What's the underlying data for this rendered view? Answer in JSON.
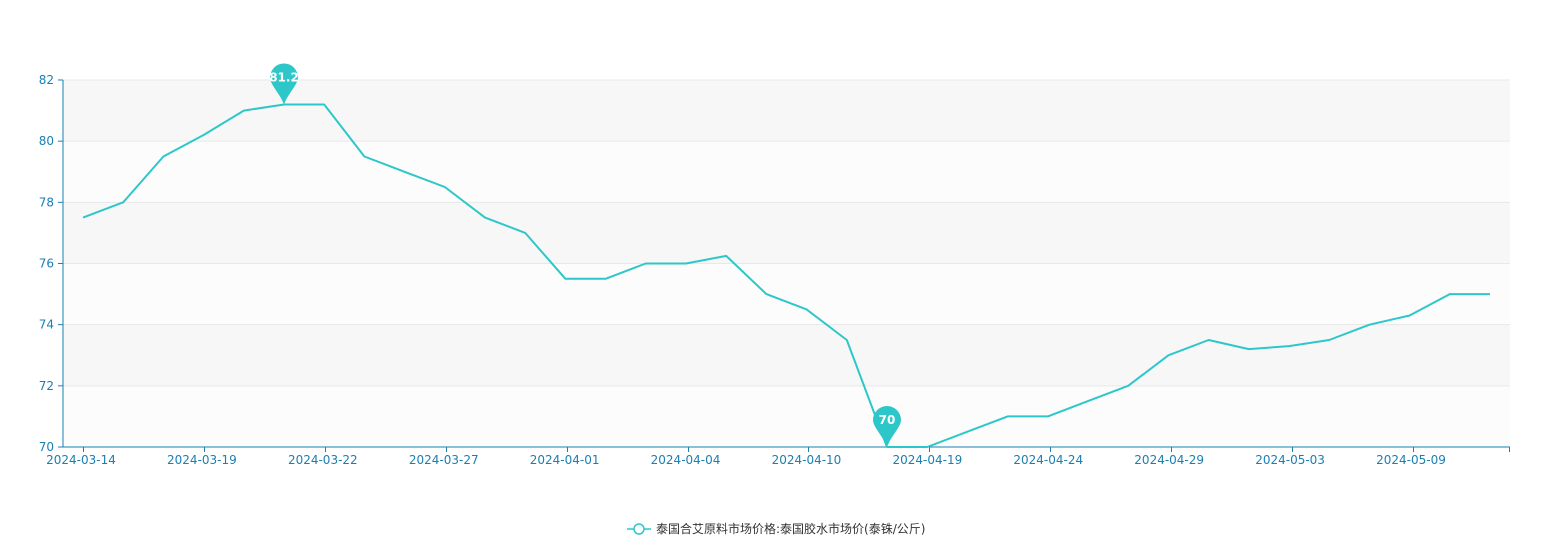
{
  "chart_data": {
    "type": "line",
    "title": "",
    "xlabel": "",
    "ylabel": "",
    "ylim": [
      70,
      82
    ],
    "yticks": [
      70,
      72,
      74,
      76,
      78,
      80,
      82
    ],
    "xtick_labels": [
      "2024-03-14",
      "2024-03-19",
      "2024-03-22",
      "2024-03-27",
      "2024-04-01",
      "2024-04-04",
      "2024-04-10",
      "2024-04-19",
      "2024-04-24",
      "2024-04-29",
      "2024-05-03",
      "2024-05-09"
    ],
    "grid": "horizontal banded",
    "legend_position": "bottom-center",
    "series": [
      {
        "name": "泰国合艾原料市场价格:泰国胶水市场价(泰铢/公斤)",
        "color": "#2ec7c9",
        "values": [
          77.5,
          78.0,
          79.5,
          80.2,
          81.0,
          81.2,
          81.2,
          79.5,
          79.0,
          78.5,
          77.5,
          77.0,
          75.5,
          75.5,
          76.0,
          76.0,
          76.25,
          75.0,
          74.5,
          73.5,
          70.0,
          70.0,
          70.5,
          71.0,
          71.0,
          71.5,
          72.0,
          73.0,
          73.5,
          73.2,
          73.3,
          73.5,
          74.0,
          74.3,
          75.0,
          75.0
        ]
      }
    ],
    "annotations": [
      {
        "type": "max",
        "label": "81.2",
        "value": 81.2,
        "index": 5
      },
      {
        "type": "min",
        "label": "70",
        "value": 70,
        "index": 20
      }
    ]
  },
  "colors": {
    "axis": "#1a7fb3",
    "band_dark": "#f7f7f7",
    "band_light": "#fcfcfc",
    "gridline": "#e8e8e8"
  }
}
